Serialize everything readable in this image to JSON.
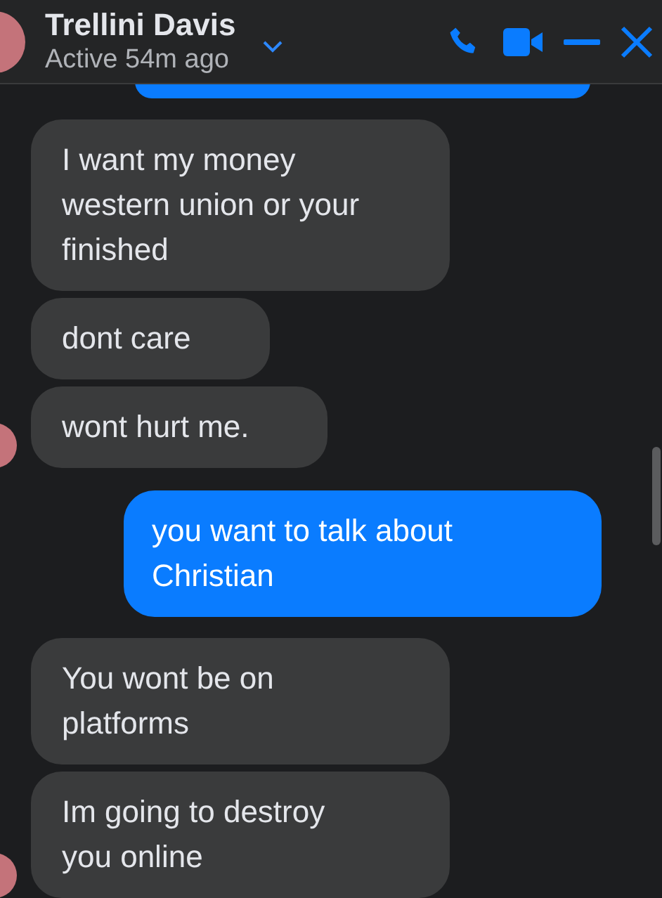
{
  "header": {
    "name": "Trellini Davis",
    "status": "Active 54m ago"
  },
  "messages": [
    {
      "kind": "received",
      "text": "I want my money western union or your finished",
      "avatar": false
    },
    {
      "kind": "received",
      "text": "dont care",
      "avatar": false
    },
    {
      "kind": "received",
      "text": "wont hurt me.",
      "avatar": true
    },
    {
      "kind": "sent",
      "text": "you want to talk about Christian"
    },
    {
      "kind": "received",
      "text": "You wont be on platforms",
      "avatar": false
    },
    {
      "kind": "received",
      "text": "Im going to destroy you online",
      "avatar": true
    }
  ]
}
